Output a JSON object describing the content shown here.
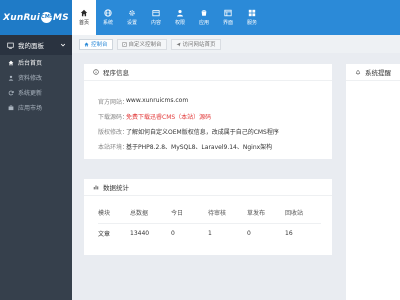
{
  "brand": {
    "prefix": "XunRui",
    "badge": "CMS",
    "suffix": "MS"
  },
  "topnav": [
    {
      "label": "首页",
      "icon": "home-icon",
      "active": true
    },
    {
      "label": "系统",
      "icon": "globe-icon",
      "active": false
    },
    {
      "label": "设置",
      "icon": "settings-icon",
      "active": false
    },
    {
      "label": "内容",
      "icon": "content-icon",
      "active": false
    },
    {
      "label": "权限",
      "icon": "user-icon",
      "active": false
    },
    {
      "label": "应用",
      "icon": "app-icon",
      "active": false
    },
    {
      "label": "界面",
      "icon": "layout-icon",
      "active": false
    },
    {
      "label": "服务",
      "icon": "service-icon",
      "active": false
    }
  ],
  "sidebar": {
    "header": "我的面板",
    "items": [
      {
        "label": "后台首页",
        "icon": "home-icon"
      },
      {
        "label": "资料修改",
        "icon": "user-icon"
      },
      {
        "label": "系统更新",
        "icon": "refresh-icon"
      },
      {
        "label": "应用市场",
        "icon": "market-icon"
      }
    ]
  },
  "tabs": [
    {
      "label": "控制台",
      "active": true
    },
    {
      "label": "自定义控制台",
      "active": false
    },
    {
      "label": "访问网站首页",
      "active": false
    }
  ],
  "program_info": {
    "title": "程序信息",
    "rows": [
      {
        "key": "官方网站：",
        "value": "www.xunruicms.com",
        "red": false
      },
      {
        "key": "下载源码：",
        "value": "免费下载迅睿CMS（本站）源码",
        "red": true
      },
      {
        "key": "版权修改：",
        "value": "了解如何自定义OEM版权信息，改成属于自己的CMS程序",
        "red": false
      },
      {
        "key": "本站环境：",
        "value": "基于PHP8.2.8、MySQL8、Laravel9.14、Nginx架构",
        "red": false
      }
    ]
  },
  "stats": {
    "title": "数据统计",
    "headers": [
      "模块",
      "总数据",
      "今日",
      "待审核",
      "草发布",
      "回收站"
    ],
    "rows": [
      [
        "文章",
        "13440",
        "0",
        "1",
        "0",
        "16"
      ]
    ]
  },
  "system_notice": {
    "title": "系统提醒"
  },
  "colors": {
    "accent": "#2b8ad8",
    "sidebar_bg": "#36404c",
    "danger": "#e23a3a"
  }
}
